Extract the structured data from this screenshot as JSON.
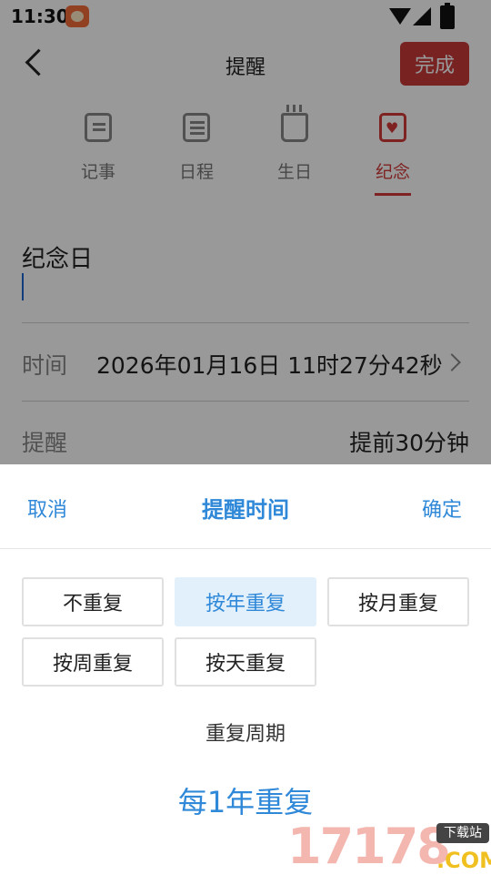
{
  "status_bar": {
    "time": "11:30"
  },
  "header": {
    "title": "提醒",
    "done_label": "完成"
  },
  "tabs": [
    {
      "label": "记事",
      "icon": "note-icon"
    },
    {
      "label": "日程",
      "icon": "list-icon"
    },
    {
      "label": "生日",
      "icon": "cake-icon"
    },
    {
      "label": "纪念",
      "icon": "heart-calendar-icon",
      "active": true
    }
  ],
  "form": {
    "title_value": "纪念日",
    "time_label": "时间",
    "time_value": "2026年01月16日 11时27分42秒",
    "remind_label": "提醒",
    "remind_value": "提前30分钟"
  },
  "sheet": {
    "cancel_label": "取消",
    "title": "提醒时间",
    "confirm_label": "确定",
    "options": [
      "不重复",
      "按年重复",
      "按月重复",
      "按周重复",
      "按天重复"
    ],
    "selected_option": "按年重复",
    "cycle_label": "重复周期",
    "cycle_value": "每1年重复"
  },
  "watermark": {
    "number": "17178",
    "tag": "下载站",
    "domain": ".COM"
  },
  "colors": {
    "accent_blue": "#2f88d8",
    "accent_red": "#d23a3a",
    "selected_bg": "#e2f0fb"
  }
}
